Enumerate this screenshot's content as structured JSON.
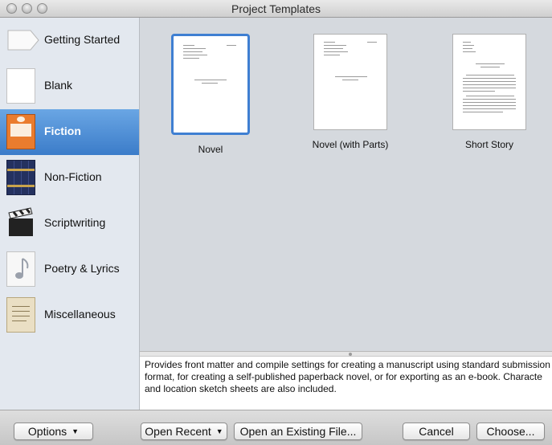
{
  "window": {
    "title": "Project Templates"
  },
  "sidebar": {
    "items": [
      {
        "label": "Getting Started",
        "icon": "arrow-document-icon",
        "selected": false
      },
      {
        "label": "Blank",
        "icon": "blank-page-icon",
        "selected": false
      },
      {
        "label": "Fiction",
        "icon": "book-cover-icon",
        "selected": true
      },
      {
        "label": "Non-Fiction",
        "icon": "books-icon",
        "selected": false
      },
      {
        "label": "Scriptwriting",
        "icon": "clapperboard-icon",
        "selected": false
      },
      {
        "label": "Poetry & Lyrics",
        "icon": "music-note-page-icon",
        "selected": false
      },
      {
        "label": "Miscellaneous",
        "icon": "ornament-page-icon",
        "selected": false
      }
    ]
  },
  "templates": [
    {
      "label": "Novel",
      "selected": true
    },
    {
      "label": "Novel (with Parts)",
      "selected": false
    },
    {
      "label": "Short Story",
      "selected": false
    }
  ],
  "description": {
    "lines": [
      "Provides front matter and compile settings for creating a manuscript using standard submission",
      "format, for creating a self-published paperback novel, or for exporting as an e-book. Characte",
      "and location sketch sheets are also included."
    ]
  },
  "buttons": {
    "options": "Options",
    "open_recent": "Open Recent",
    "open_existing": "Open an Existing File...",
    "cancel": "Cancel",
    "choose": "Choose..."
  },
  "colors": {
    "selection": "#3b7cc9",
    "accent_border": "#3f7fd2"
  }
}
